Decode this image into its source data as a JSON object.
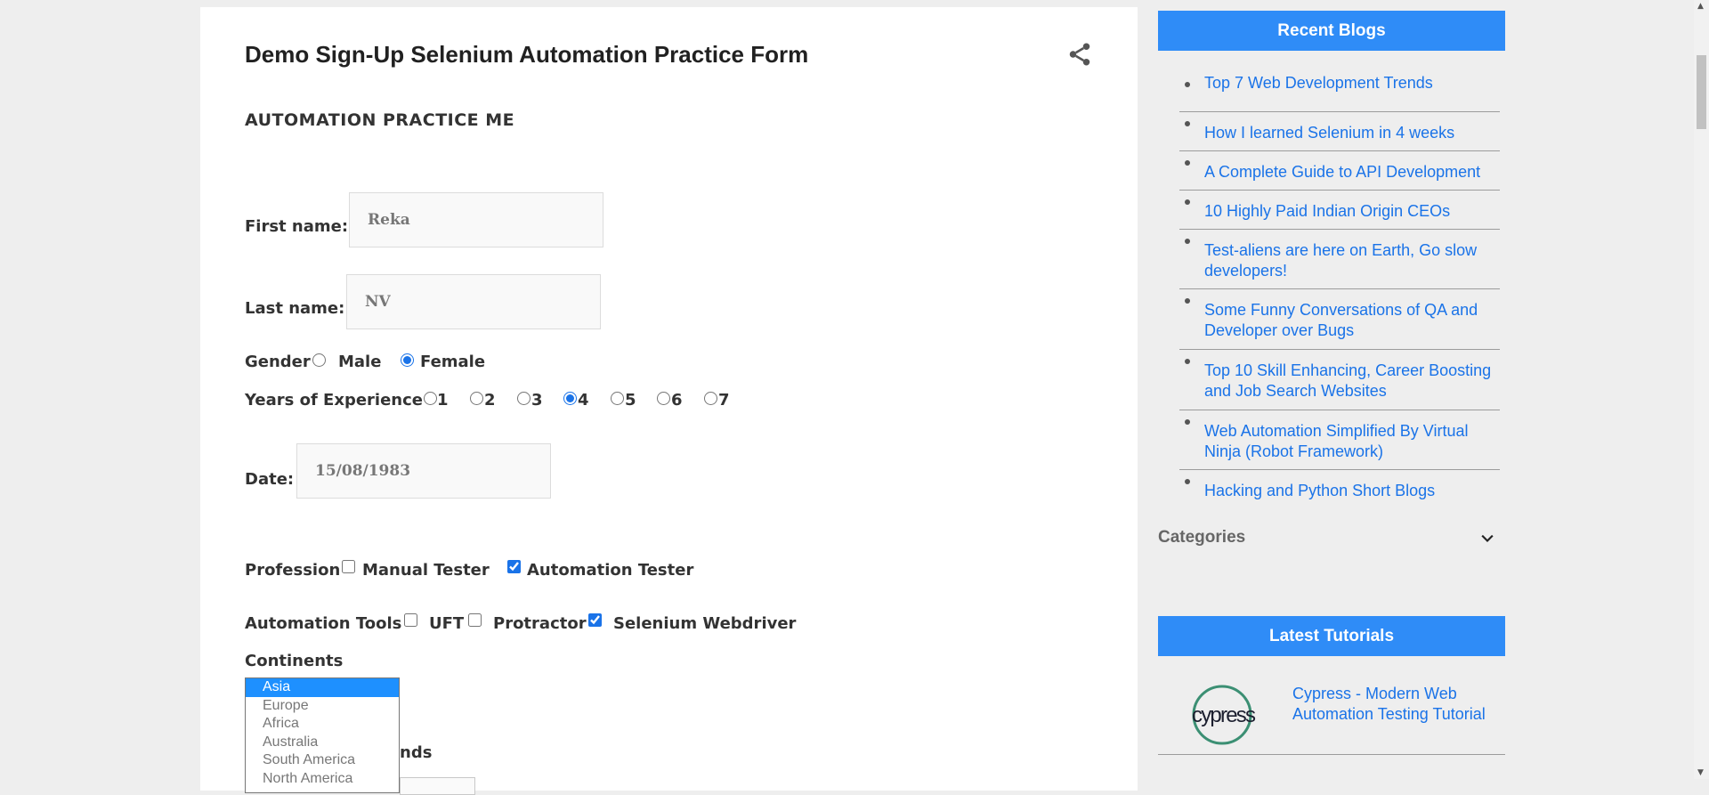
{
  "post": {
    "title": "Demo Sign-Up Selenium Automation Practice Form",
    "section_title": "AUTOMATION PRACTICE ME"
  },
  "form": {
    "first_name_label": "First name:",
    "first_name_value": "Reka",
    "last_name_label": "Last name:",
    "last_name_value": "NV",
    "gender_label": "Gender",
    "gender_options": [
      "Male",
      "Female"
    ],
    "gender_selected": "Female",
    "experience_label": "Years of Experience",
    "experience_options": [
      "1",
      "2",
      "3",
      "4",
      "5",
      "6",
      "7"
    ],
    "experience_selected": "4",
    "date_label": "Date:",
    "date_value": "15/08/1983",
    "profession_label": "Profession",
    "profession_options": [
      "Manual Tester",
      "Automation Tester"
    ],
    "profession_checked": [
      "Automation Tester"
    ],
    "tools_label": "Automation Tools",
    "tools_options": [
      "UFT",
      "Protractor",
      "Selenium Webdriver"
    ],
    "tools_checked": [
      "Selenium Webdriver"
    ],
    "continents_label": "Continents",
    "continents_options": [
      "Asia",
      "Europe",
      "Africa",
      "Australia",
      "South America",
      "North America"
    ],
    "continents_selected": "Asia",
    "partial_label": "nds"
  },
  "sidebar": {
    "recent_blogs_title": "Recent Blogs",
    "recent_blogs": [
      "Top 7 Web Development Trends",
      "How I learned Selenium in 4 weeks",
      "A Complete Guide to API Development",
      "10 Highly Paid Indian Origin CEOs",
      "Test-aliens are here on Earth, Go slow developers!",
      "Some Funny Conversations of QA and Developer over Bugs",
      "Top 10 Skill Enhancing, Career Boosting and Job Search Websites",
      "Web Automation Simplified By Virtual Ninja (Robot Framework)",
      "Hacking and Python Short Blogs"
    ],
    "categories_label": "Categories",
    "latest_tutorials_title": "Latest Tutorials",
    "tutorial_logo_text": "cypress",
    "tutorial_link": "Cypress - Modern Web Automation Testing Tutorial"
  },
  "icons": {
    "share": "share-icon",
    "chevron": "chevron-down-icon"
  },
  "colors": {
    "accent": "#2f8cf7",
    "link": "#1a73e8",
    "cypress_green": "#3b8f73"
  }
}
